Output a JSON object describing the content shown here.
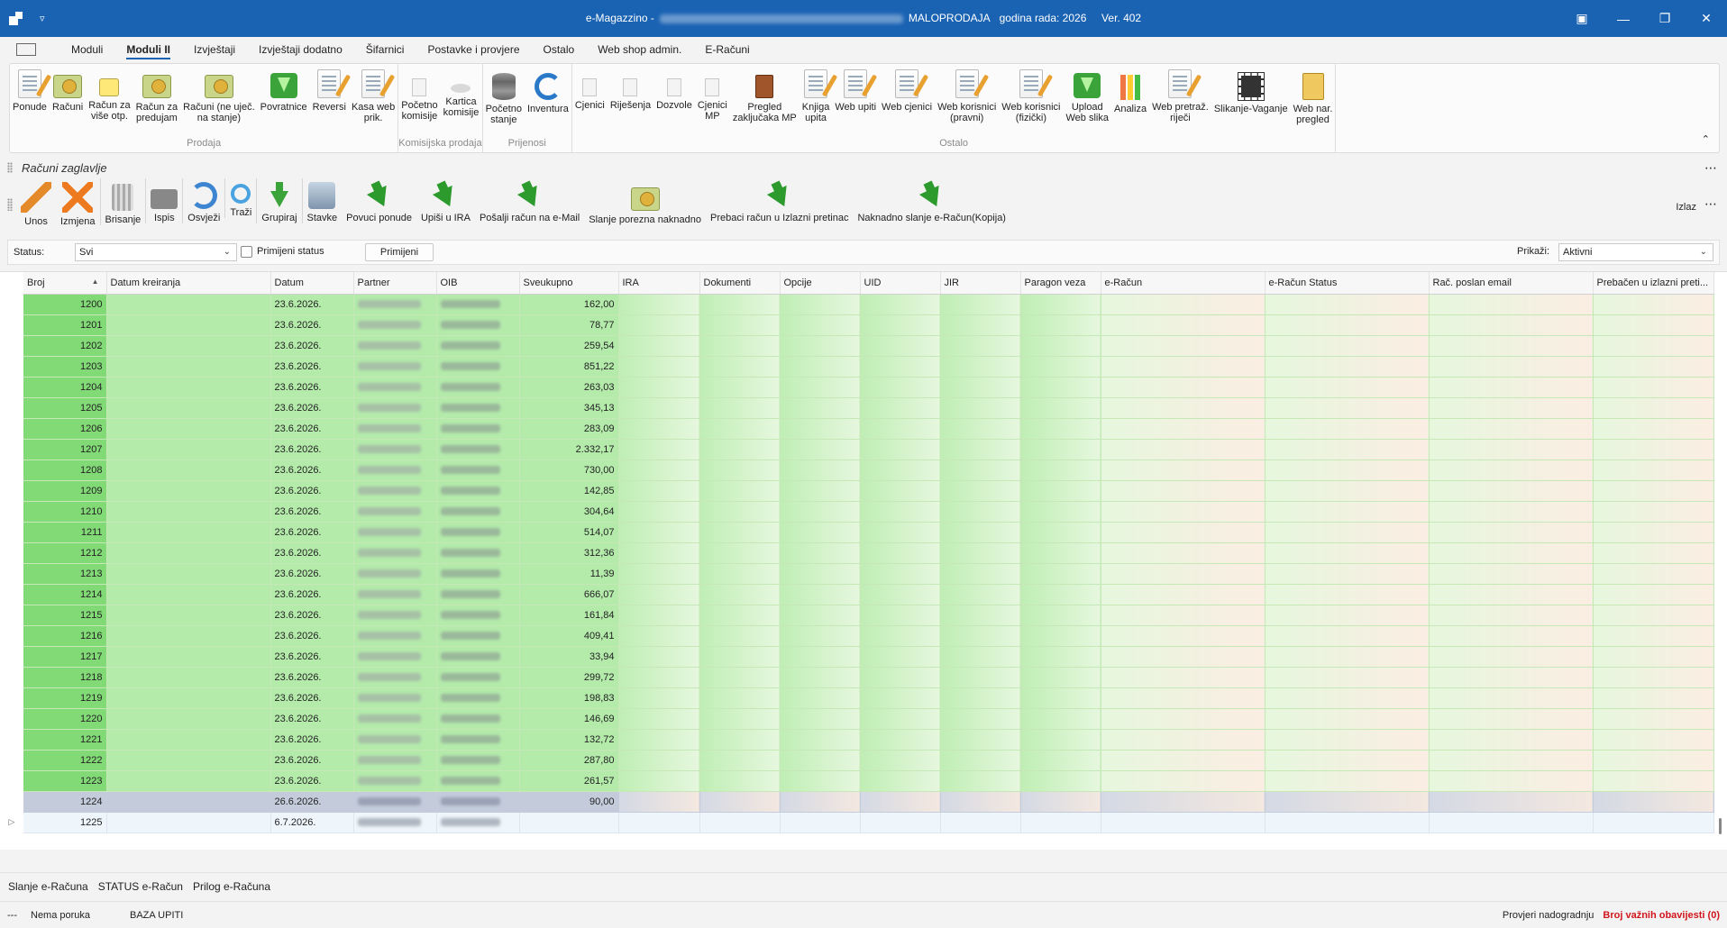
{
  "titlebar": {
    "app_name": "e-Magazzino -",
    "mode": "MALOPRODAJA",
    "year_label": "godina rada: 2026",
    "version": "Ver. 402"
  },
  "menu": {
    "tabs": [
      {
        "label": "Moduli",
        "active": false
      },
      {
        "label": "Moduli II",
        "active": true
      },
      {
        "label": "Izvještaji",
        "active": false
      },
      {
        "label": "Izvještaji dodatno",
        "active": false
      },
      {
        "label": "Šifarnici",
        "active": false
      },
      {
        "label": "Postavke i provjere",
        "active": false
      },
      {
        "label": "Ostalo",
        "active": false
      },
      {
        "label": "Web shop admin.",
        "active": false
      },
      {
        "label": "E-Računi",
        "active": false
      }
    ]
  },
  "ribbon": {
    "groups": [
      {
        "label": "Prodaja",
        "items": [
          {
            "label": "Ponude",
            "icon": "document-pen-icon"
          },
          {
            "label": "Računi",
            "icon": "money-icon"
          },
          {
            "label": "Račun za\nviše otp.",
            "icon": "money-stack-icon"
          },
          {
            "label": "Račun za\npredujam",
            "icon": "money-icon"
          },
          {
            "label": "Računi (ne uječ.\nna stanje)",
            "icon": "money-icon"
          },
          {
            "label": "Povratnice",
            "icon": "green-arrow-icon"
          },
          {
            "label": "Reversi",
            "icon": "document-pen-icon"
          },
          {
            "label": "Kasa web\nprik.",
            "icon": "document-pen-icon"
          }
        ]
      },
      {
        "label": "Komisijska prodaja",
        "items": [
          {
            "label": "Početno\nkomisije",
            "icon": "grey-document-icon"
          },
          {
            "label": "Kartica\nkomisije",
            "icon": "grey-flat-icon"
          }
        ]
      },
      {
        "label": "Prijenosi",
        "items": [
          {
            "label": "Početno\nstanje",
            "icon": "database-icon"
          },
          {
            "label": "Inventura",
            "icon": "refresh-icon"
          }
        ]
      },
      {
        "label": "Ostalo",
        "items": [
          {
            "label": "Cjenici",
            "icon": "grey-document-icon"
          },
          {
            "label": "Riješenja",
            "icon": "grey-document-icon"
          },
          {
            "label": "Dozvole",
            "icon": "grey-document-icon"
          },
          {
            "label": "Cjenici\nMP",
            "icon": "grey-document-icon"
          },
          {
            "label": "Pregled\nzaključaka MP",
            "icon": "book-icon"
          },
          {
            "label": "Knjiga\nupita",
            "icon": "document-pen-icon"
          },
          {
            "label": "Web upiti",
            "icon": "document-pen-icon"
          },
          {
            "label": "Web cjenici",
            "icon": "document-pen-icon"
          },
          {
            "label": "Web korisnici\n(pravni)",
            "icon": "document-pen-icon"
          },
          {
            "label": "Web korisnici\n(fizički)",
            "icon": "document-pen-icon"
          },
          {
            "label": "Upload\nWeb slika",
            "icon": "green-arrow-icon"
          },
          {
            "label": "Analiza",
            "icon": "bar-chart-icon"
          },
          {
            "label": "Web pretraž.\nriječi",
            "icon": "document-pen-icon"
          },
          {
            "label": "Slikanje-Vaganje",
            "icon": "film-icon"
          },
          {
            "label": "Web nar.\npregled",
            "icon": "folder-icon"
          }
        ]
      }
    ]
  },
  "section": {
    "title": "Računi zaglavlje"
  },
  "toolbar": {
    "buttons": [
      {
        "label": "Unos",
        "icon": "pencil-icon"
      },
      {
        "label": "Izmjena",
        "icon": "cross-icon"
      },
      {
        "label": "Brisanje",
        "icon": "trash-icon"
      },
      {
        "label": "Ispis",
        "icon": "printer-icon"
      },
      {
        "label": "Osvježi",
        "icon": "refresh-icon"
      },
      {
        "label": "Traži",
        "icon": "search-icon"
      },
      {
        "label": "Grupiraj",
        "icon": "download-icon"
      },
      {
        "label": "Stavke",
        "icon": "hdd-icon"
      },
      {
        "label": "Povuci ponude",
        "icon": "green-arrow-icon"
      },
      {
        "label": "Upiši u IRA",
        "icon": "green-arrow-icon"
      },
      {
        "label": "Pošalji račun na e-Mail",
        "icon": "green-arrow-icon"
      },
      {
        "label": "Slanje porezna naknadno",
        "icon": "money-icon"
      },
      {
        "label": "Prebaci račun u Izlazni pretinac",
        "icon": "green-arrow-icon"
      },
      {
        "label": "Naknadno slanje e-Račun(Kopija)",
        "icon": "green-arrow-icon"
      }
    ],
    "exit_label": "Izlaz"
  },
  "filters": {
    "status_label": "Status:",
    "status_value": "Svi",
    "apply_status_label": "Primijeni status",
    "apply_button": "Primijeni",
    "show_label": "Prikaži:",
    "show_value": "Aktivni"
  },
  "grid": {
    "columns": [
      "Broj",
      "Datum kreiranja",
      "Datum",
      "Partner",
      "OIB",
      "Sveukupno",
      "IRA",
      "Dokumenti",
      "Opcije",
      "UID",
      "JIR",
      "Paragon veza",
      "e-Račun",
      "e-Račun Status",
      "Rač. poslan email",
      "Prebačen u izlazni preti..."
    ],
    "rows": [
      {
        "broj": "1200",
        "datum": "23.6.2026.",
        "sveukupno": "162,00"
      },
      {
        "broj": "1201",
        "datum": "23.6.2026.",
        "sveukupno": "78,77"
      },
      {
        "broj": "1202",
        "datum": "23.6.2026.",
        "sveukupno": "259,54"
      },
      {
        "broj": "1203",
        "datum": "23.6.2026.",
        "sveukupno": "851,22"
      },
      {
        "broj": "1204",
        "datum": "23.6.2026.",
        "sveukupno": "263,03"
      },
      {
        "broj": "1205",
        "datum": "23.6.2026.",
        "sveukupno": "345,13"
      },
      {
        "broj": "1206",
        "datum": "23.6.2026.",
        "sveukupno": "283,09"
      },
      {
        "broj": "1207",
        "datum": "23.6.2026.",
        "sveukupno": "2.332,17"
      },
      {
        "broj": "1208",
        "datum": "23.6.2026.",
        "sveukupno": "730,00"
      },
      {
        "broj": "1209",
        "datum": "23.6.2026.",
        "sveukupno": "142,85"
      },
      {
        "broj": "1210",
        "datum": "23.6.2026.",
        "sveukupno": "304,64"
      },
      {
        "broj": "1211",
        "datum": "23.6.2026.",
        "sveukupno": "514,07"
      },
      {
        "broj": "1212",
        "datum": "23.6.2026.",
        "sveukupno": "312,36"
      },
      {
        "broj": "1213",
        "datum": "23.6.2026.",
        "sveukupno": "11,39"
      },
      {
        "broj": "1214",
        "datum": "23.6.2026.",
        "sveukupno": "666,07"
      },
      {
        "broj": "1215",
        "datum": "23.6.2026.",
        "sveukupno": "161,84"
      },
      {
        "broj": "1216",
        "datum": "23.6.2026.",
        "sveukupno": "409,41"
      },
      {
        "broj": "1217",
        "datum": "23.6.2026.",
        "sveukupno": "33,94"
      },
      {
        "broj": "1218",
        "datum": "23.6.2026.",
        "sveukupno": "299,72"
      },
      {
        "broj": "1219",
        "datum": "23.6.2026.",
        "sveukupno": "198,83"
      },
      {
        "broj": "1220",
        "datum": "23.6.2026.",
        "sveukupno": "146,69"
      },
      {
        "broj": "1221",
        "datum": "23.6.2026.",
        "sveukupno": "132,72"
      },
      {
        "broj": "1222",
        "datum": "23.6.2026.",
        "sveukupno": "287,80"
      },
      {
        "broj": "1223",
        "datum": "23.6.2026.",
        "sveukupno": "261,57"
      },
      {
        "broj": "1224",
        "datum": "26.6.2026.",
        "sveukupno": "90,00",
        "selected": true
      },
      {
        "broj": "1225",
        "datum": "6.7.2026.",
        "sveukupno": "",
        "new": true
      }
    ]
  },
  "bottom_tabs": [
    "Slanje e-Računa",
    "STATUS e-Račun",
    "Prilog e-Računa"
  ],
  "statusbar": {
    "dots": "---",
    "message": "Nema poruka",
    "database": "BAZA UPITI",
    "check_updates": "Provjeri nadogradnju",
    "important_notices": "Broj važnih obavijesti (0)"
  },
  "colors": {
    "titlebar": "#1a63b3",
    "row_green": "#b4ebab",
    "row_number_green": "#82da76",
    "selected_row": "#c4ccdc",
    "important": "#d0161c"
  }
}
